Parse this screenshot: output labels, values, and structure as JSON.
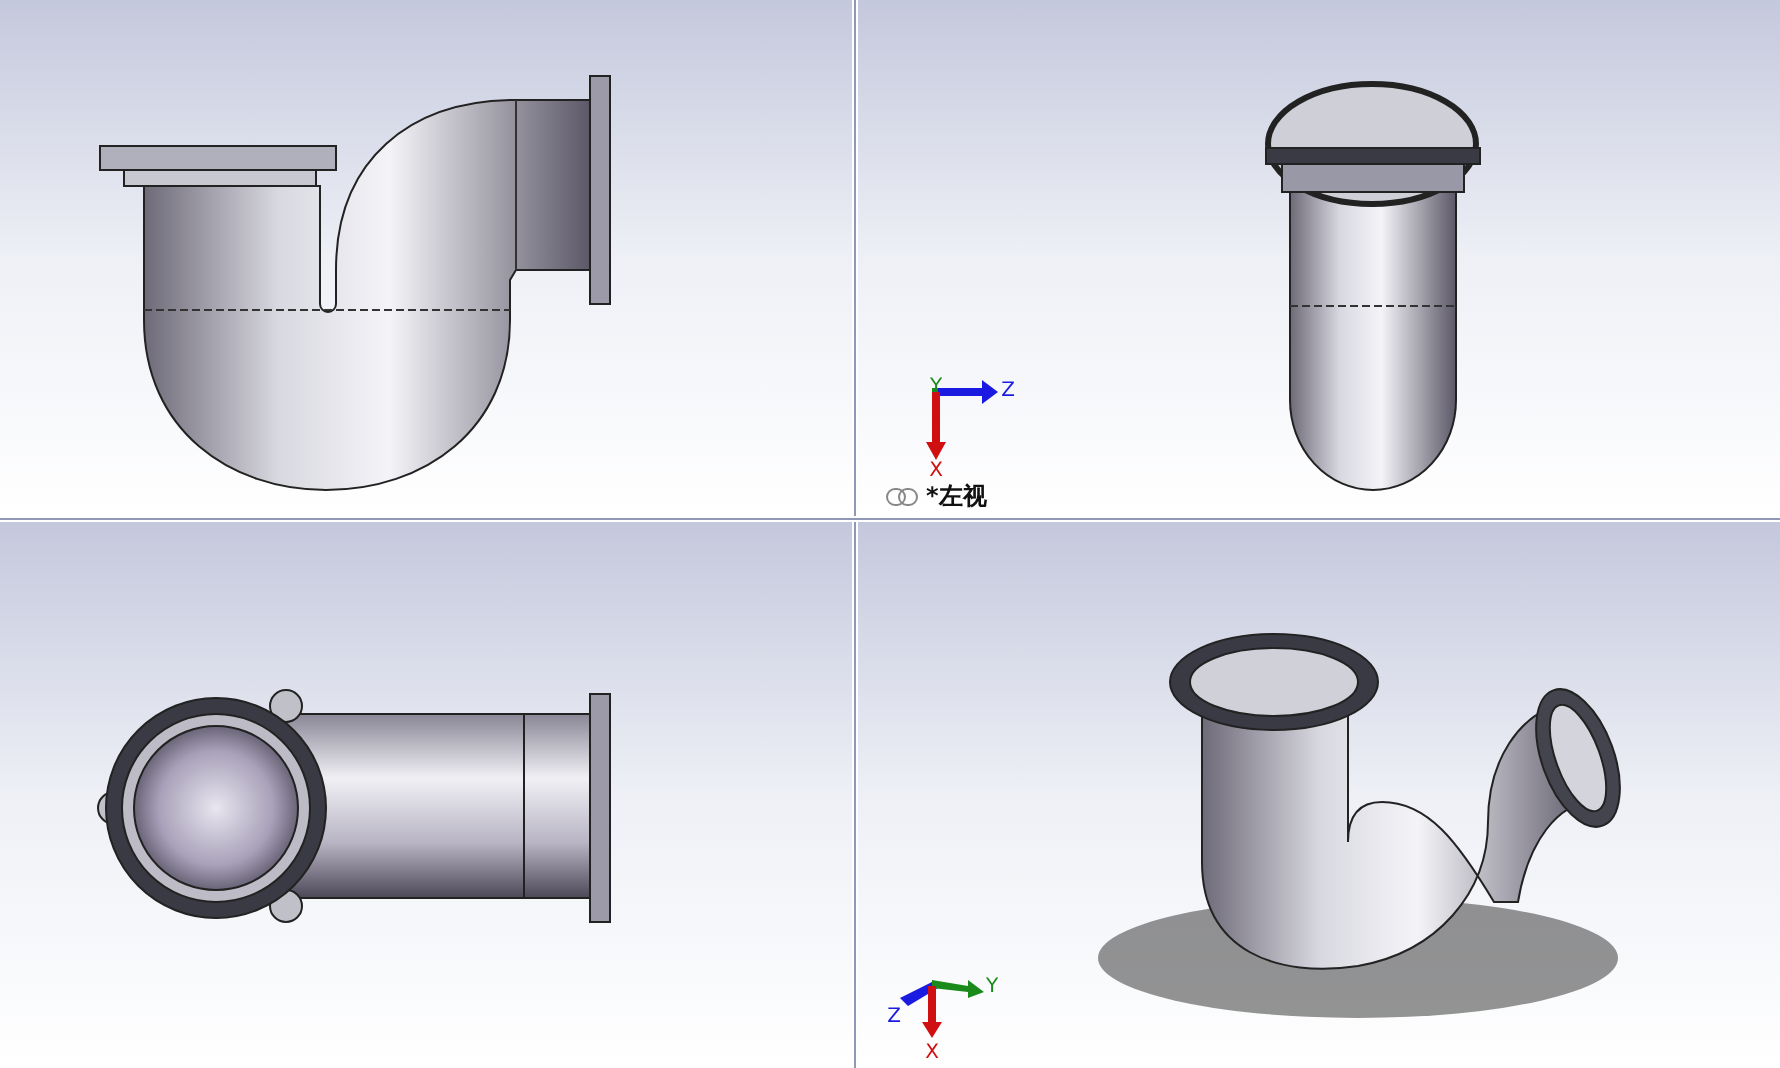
{
  "viewports": [
    {
      "kind": "front"
    },
    {
      "kind": "left",
      "triad": {
        "kind": "planar",
        "axes": [
          {
            "label": "Y",
            "color": "#1a8a1a"
          },
          {
            "label": "Z",
            "color": "#1a1ae0"
          },
          {
            "label": "X",
            "color": "#d01010"
          }
        ]
      },
      "label": "*左视"
    },
    {
      "kind": "top"
    },
    {
      "kind": "iso",
      "triad": {
        "kind": "iso",
        "axes": [
          {
            "label": "Z",
            "color": "#1a1ae0"
          },
          {
            "label": "Y",
            "color": "#1a8a1a"
          },
          {
            "label": "X",
            "color": "#d01010"
          }
        ]
      }
    }
  ]
}
